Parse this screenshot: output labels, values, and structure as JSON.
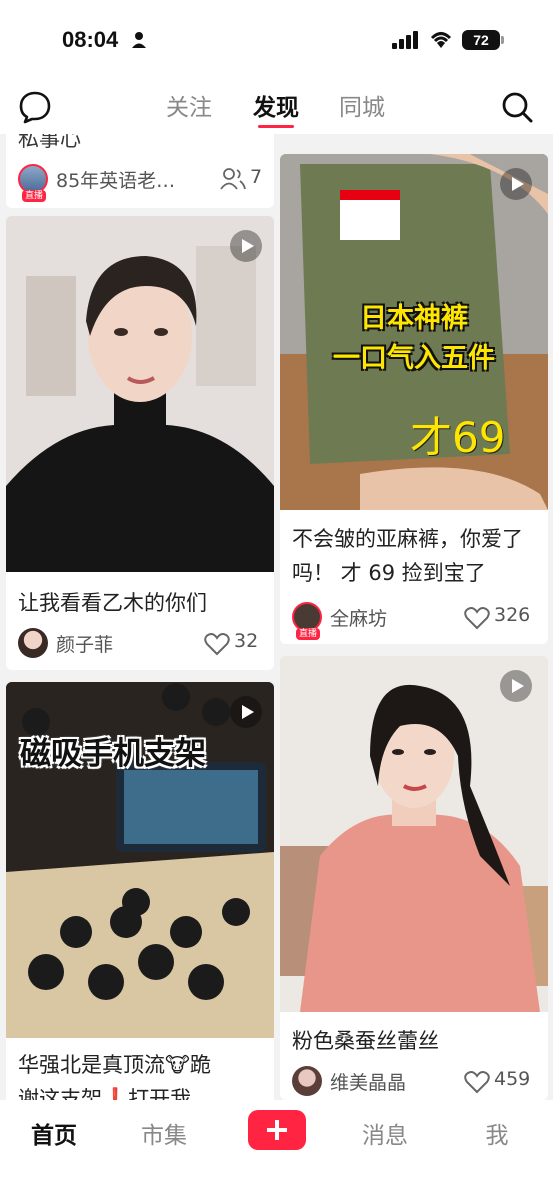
{
  "status_bar": {
    "time": "08:04",
    "battery": "72"
  },
  "top_nav": {
    "tabs": [
      {
        "label": "关注",
        "active": false
      },
      {
        "label": "发现",
        "active": true
      },
      {
        "label": "同城",
        "active": false
      }
    ]
  },
  "feed": {
    "cards": [
      {
        "title": "私事心",
        "author": "85年英语老…",
        "live_tag": "直播",
        "count": "7",
        "count_icon": "people-icon"
      },
      {
        "title": "不会皱的亚麻裤，你爱了吗！ 才 69 捡到宝了",
        "image_text": [
          "日本神裤",
          "一口气入五件",
          "才69"
        ],
        "author": "全麻坊",
        "live_tag": "直播",
        "likes": "326",
        "video": true
      },
      {
        "title": "让我看看乙木的你们",
        "author": "颜子菲",
        "likes": "32",
        "video": true
      },
      {
        "title": "粉色桑蚕丝蕾丝",
        "author": "维美晶晶",
        "likes": "459",
        "video": true
      },
      {
        "title": "华强北是真顶流🐮跪",
        "title_line2": "谢这支架❗️打开我",
        "image_text": [
          "磁吸手机支架"
        ],
        "video": true
      }
    ]
  },
  "bottom_bar": {
    "items": [
      {
        "label": "首页",
        "active": true
      },
      {
        "label": "市集",
        "active": false
      },
      {
        "label": "消息",
        "active": false
      },
      {
        "label": "我",
        "active": false
      }
    ],
    "plus_icon": "plus-icon"
  },
  "colors": {
    "accent": "#ff2442"
  }
}
